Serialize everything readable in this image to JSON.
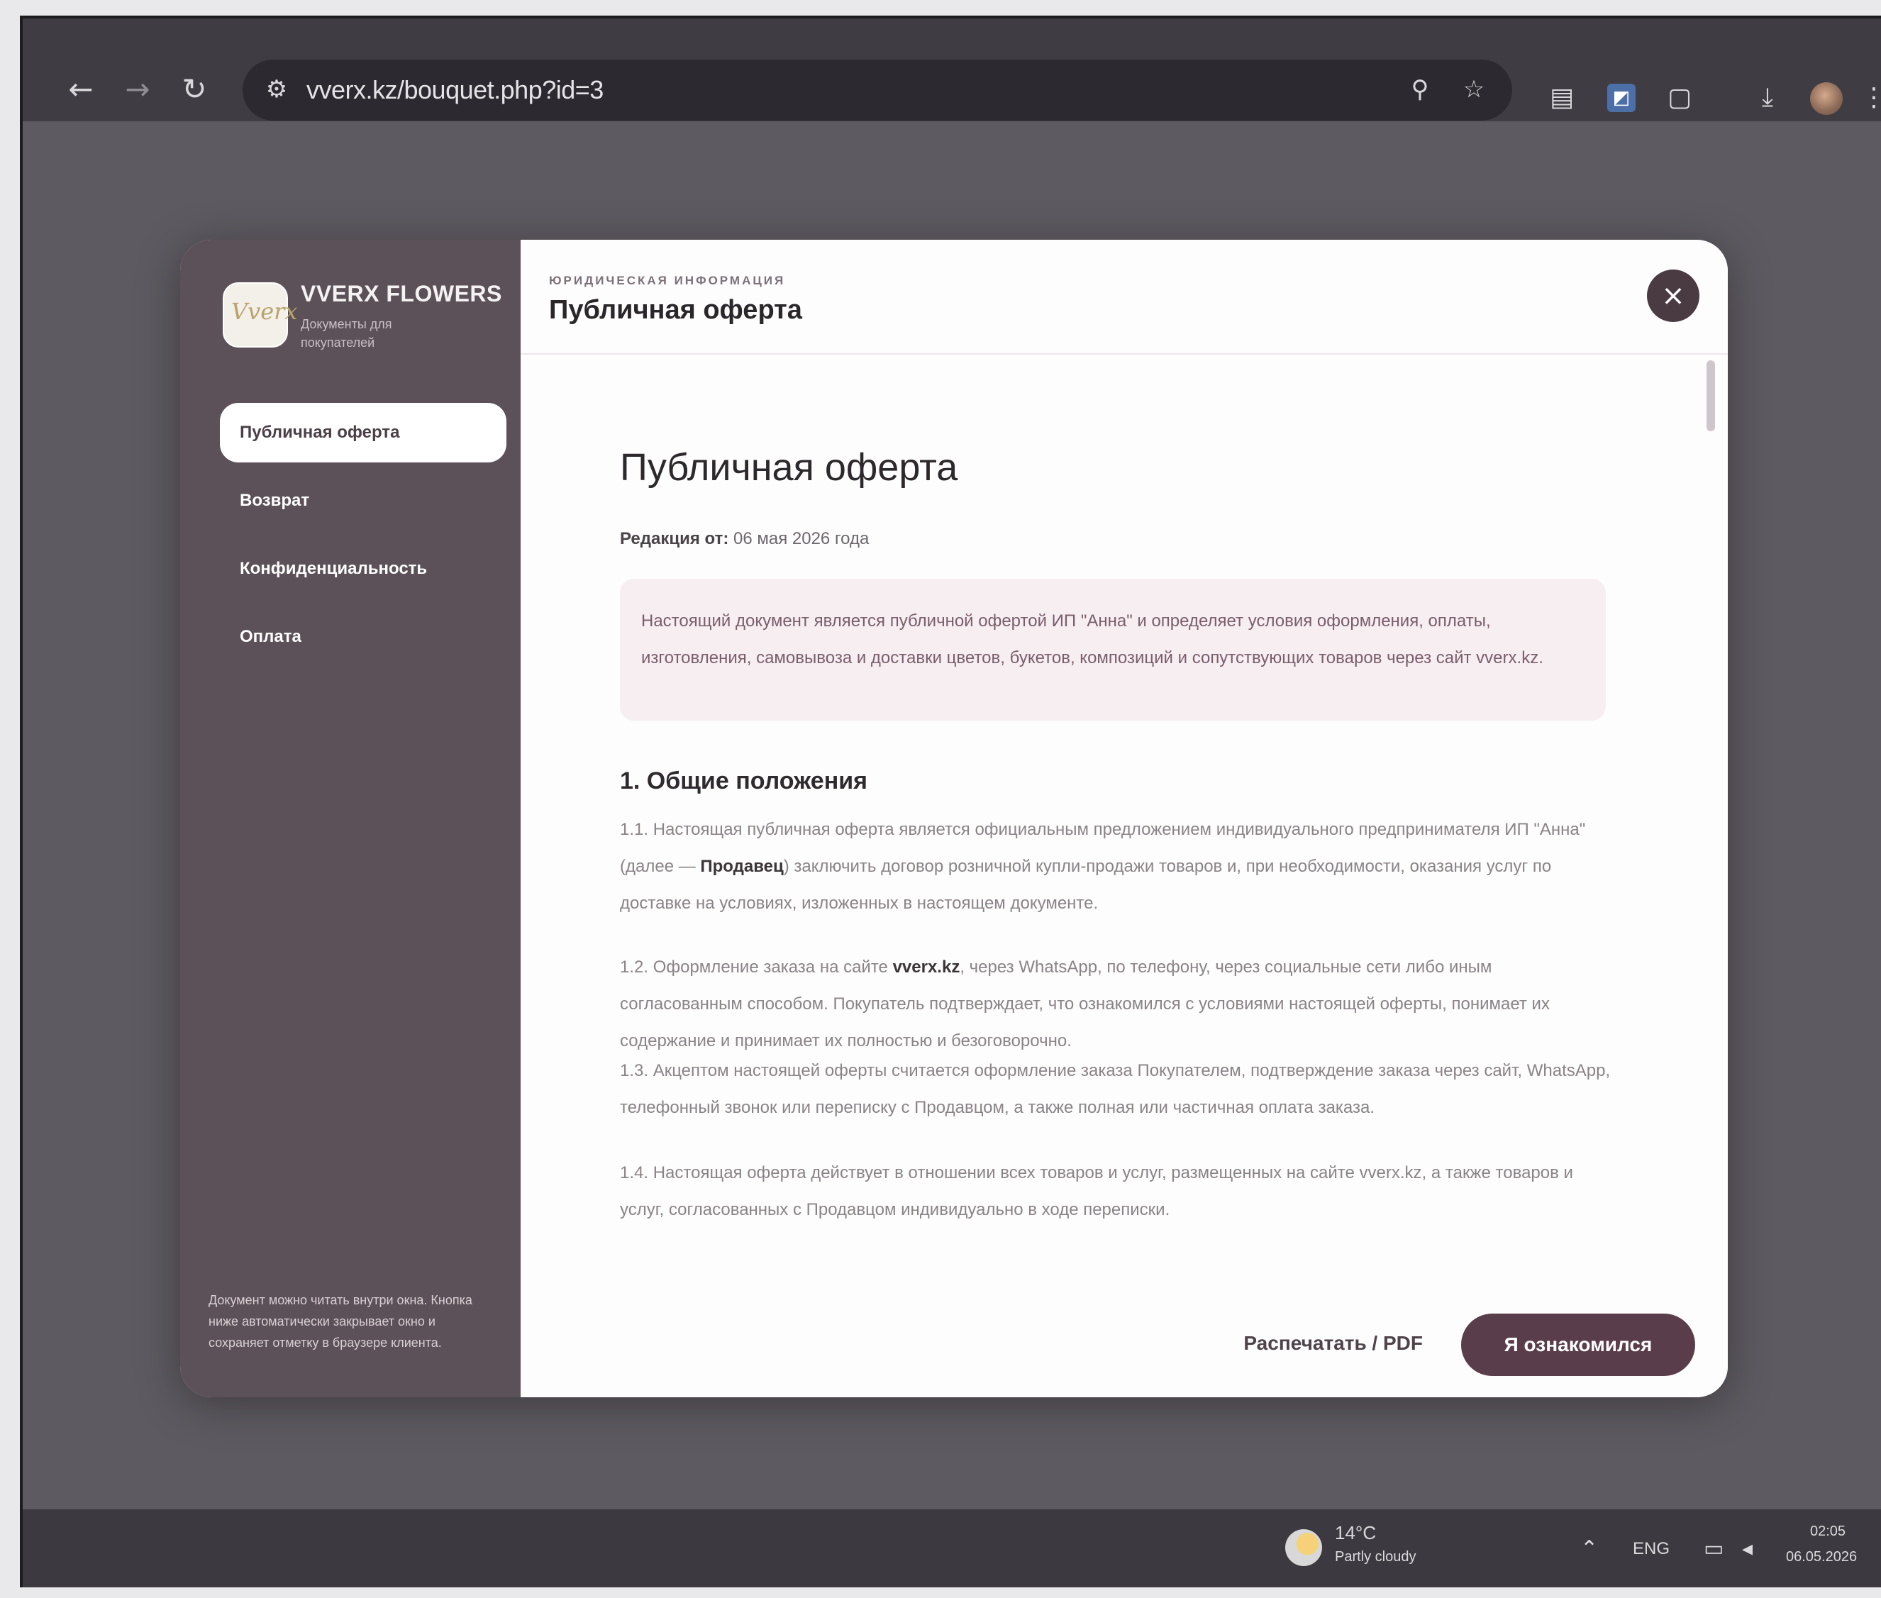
{
  "browser": {
    "url": "vverx.kz/bouquet.php?id=3",
    "icons": [
      "back-icon",
      "forward-icon",
      "reload-icon",
      "site-info-icon",
      "zoom-icon",
      "star-icon",
      "extension-icon",
      "extension-icon",
      "extension-icon",
      "download-icon",
      "profile-avatar",
      "menu-icon"
    ]
  },
  "sidebar": {
    "brand_name": "VVERX FLOWERS",
    "brand_sub": "Документы для покупателей",
    "items": [
      {
        "label": "Публичная оферта"
      },
      {
        "label": "Возврат"
      },
      {
        "label": "Конфиденциальность"
      },
      {
        "label": "Оплата"
      }
    ],
    "note": "Документ можно читать внутри окна. Кнопка ниже автоматически закрывает окно и сохраняет отметку в браузере клиента."
  },
  "modal": {
    "eyebrow": "ЮРИДИЧЕСКАЯ ИНФОРМАЦИЯ",
    "title": "Публичная оферта",
    "close_label": "×",
    "footer": {
      "print_label": "Распечатать / PDF",
      "ack_label": "Я ознакомился"
    }
  },
  "document": {
    "title": "Публичная оферта",
    "edition_label": "Редакция от:",
    "edition_date": "06 мая 2026 года",
    "intro": "Настоящий документ является публичной офертой ИП \"Анна\" и определяет условия оформления, оплаты, изготовления, самовывоза и доставки цветов, букетов, композиций и сопутствующих товаров через сайт vverx.kz.",
    "section_heading": "1. Общие положения",
    "p1_a": "1.1. Настоящая публичная оферта является официальным предложением индивидуального предпринимателя ИП \"Анна\" (далее — ",
    "p1_b": "Продавец",
    "p1_c": ") заключить договор розничной купли-продажи товаров и, при необходимости, оказания услуг по доставке на условиях, изложенных в настоящем документе.",
    "p2_a": "1.2. Оформление заказа на сайте ",
    "p2_b": "vverx.kz",
    "p2_c": ", через WhatsApp, по телефону, через социальные сети либо иным согласованным способом. Покупатель подтверждает, что ознакомился с условиями настоящей оферты, понимает их содержание и принимает их полностью и безоговорочно.",
    "p3": "1.3. Акцептом настоящей оферты считается оформление заказа Покупателем, подтверждение заказа через сайт, WhatsApp, телефонный звонок или переписку с Продавцом, а также полная или частичная оплата заказа.",
    "p4": "1.4. Настоящая оферта действует в отношении всех товаров и услуг, размещенных на сайте vverx.kz, а также товаров и услуг, согласованных с Продавцом индивидуально в ходе переписки."
  },
  "taskbar": {
    "temperature": "14°C",
    "weather": "Partly cloudy",
    "language": "ENG",
    "time": "02:05",
    "date": "06.05.2026"
  }
}
